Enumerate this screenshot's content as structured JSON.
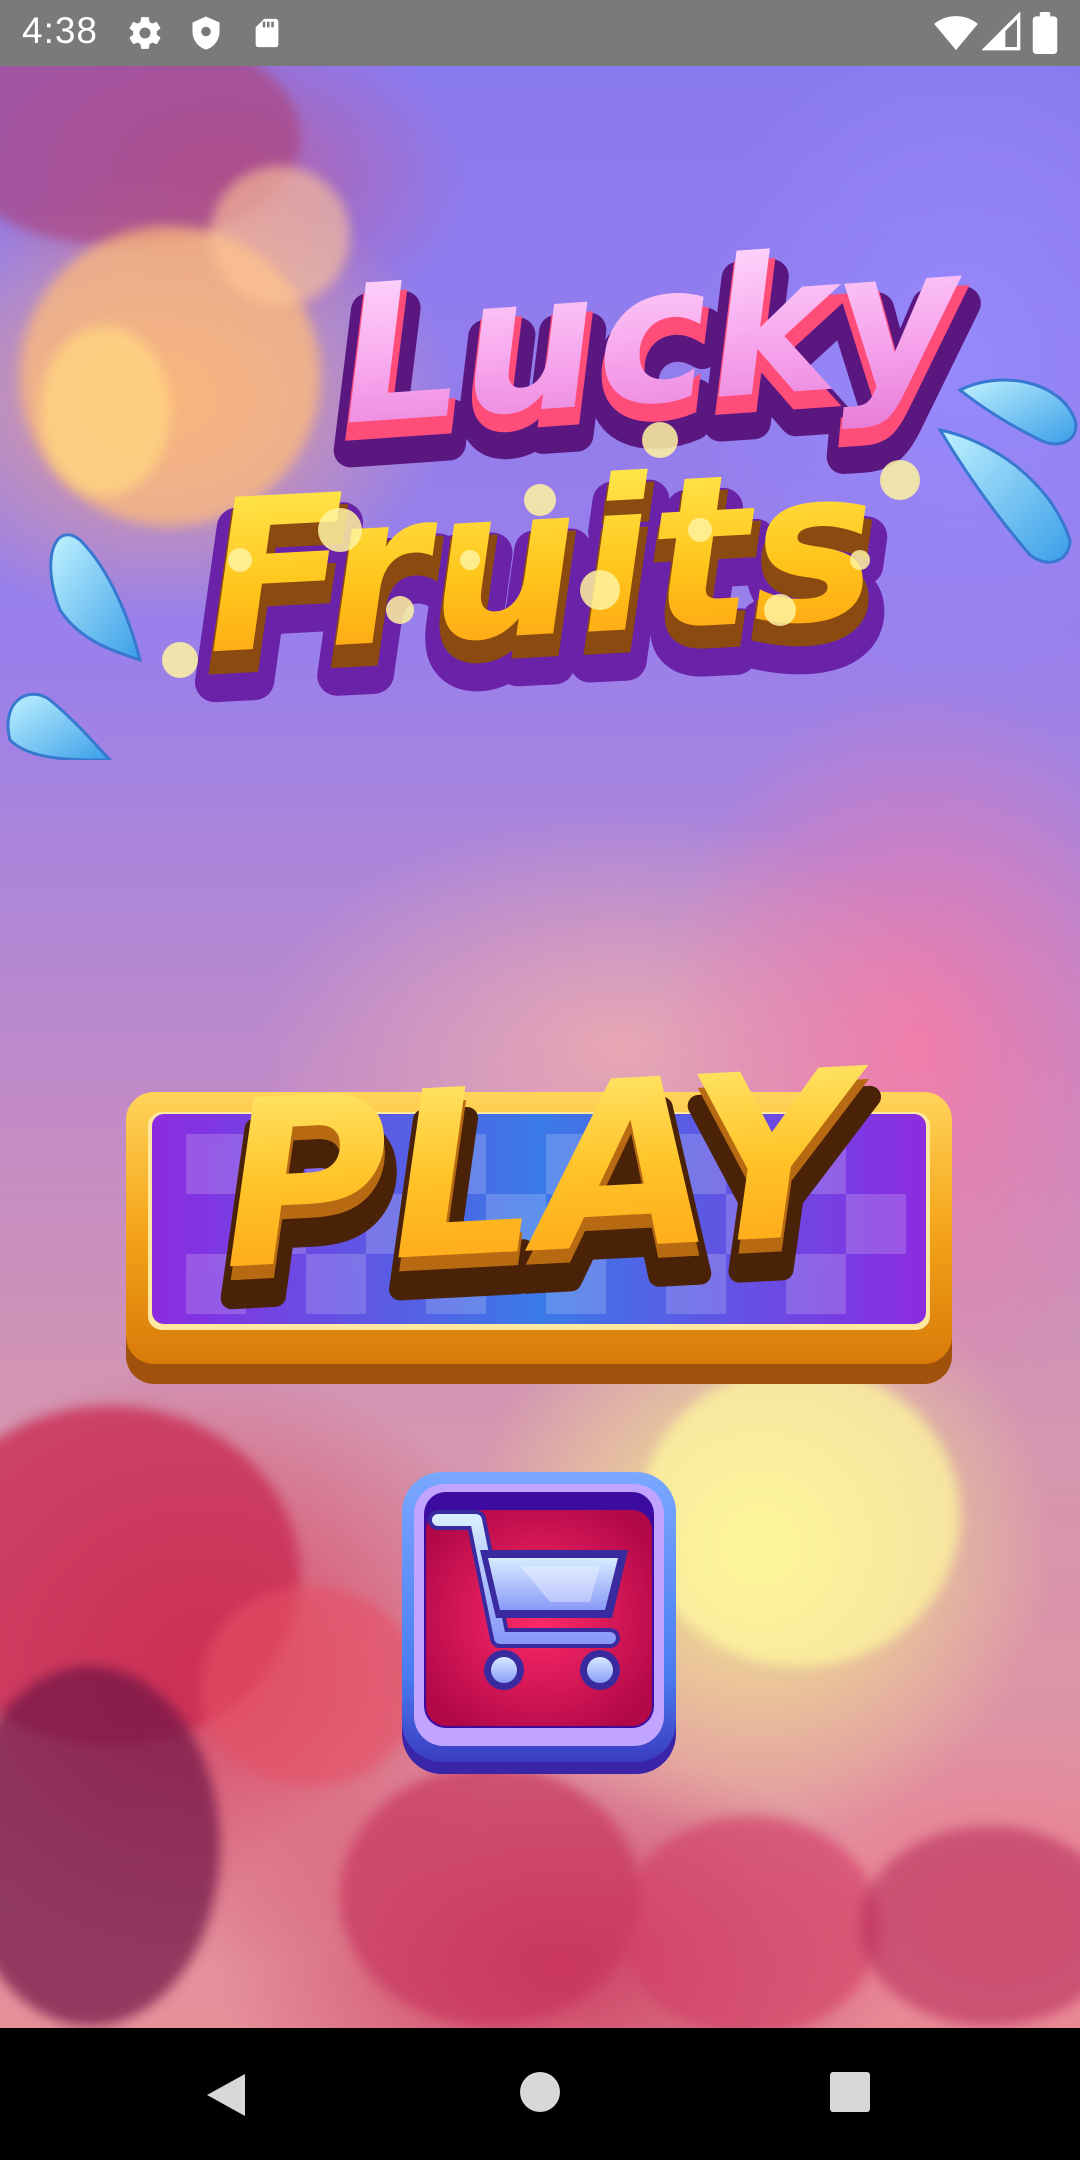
{
  "status_bar": {
    "time": "4:38",
    "left_icons": [
      "gear-icon",
      "shield-icon",
      "sd-card-icon"
    ],
    "right_icons": [
      "wifi-icon",
      "signal-icon",
      "battery-icon"
    ]
  },
  "game": {
    "title_line1": "Lucky",
    "title_line2": "Fruits",
    "play_label": "PLAY",
    "shop_icon": "shopping-cart-icon",
    "colors": {
      "title_pink": "#f7a8e8",
      "title_yellow": "#ffc21a",
      "outline_purple": "#7b2fb0",
      "play_frame_gold": "#f5a51a",
      "play_panel_purple": "#8c2be0",
      "shop_frame_blue": "#4a7cf0",
      "shop_panel_red": "#e0125a"
    }
  },
  "nav_bar": {
    "buttons": [
      "back-icon",
      "home-icon",
      "recents-icon"
    ]
  }
}
